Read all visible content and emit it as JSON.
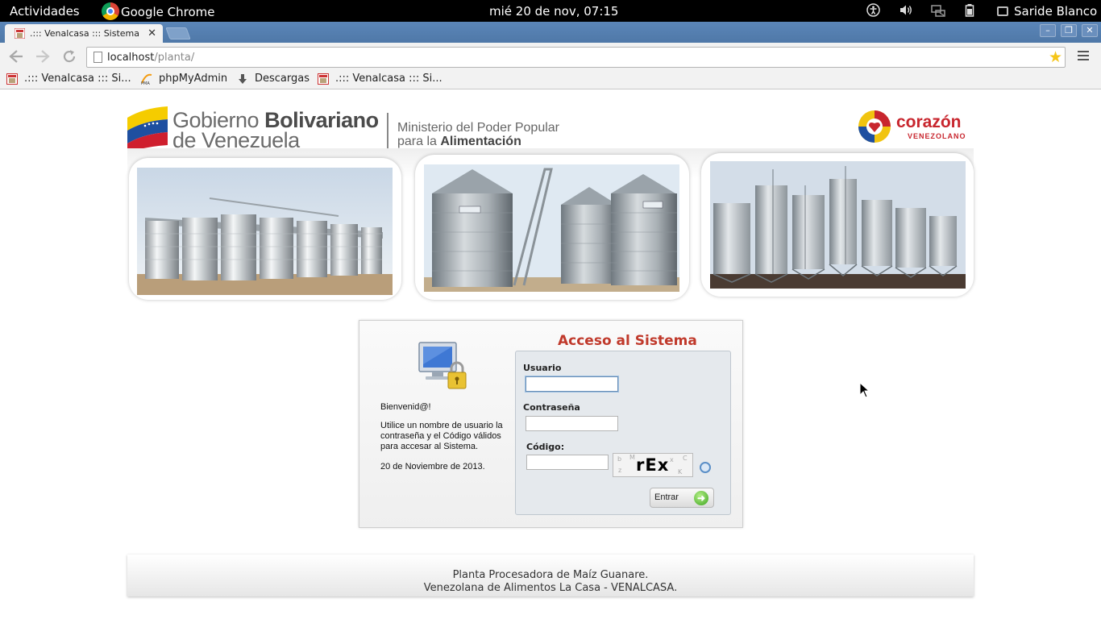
{
  "topbar": {
    "activities": "Actividades",
    "app_name": "Google Chrome",
    "clock": "mié 20 de nov, 07:15",
    "user_name": "Saride Blanco"
  },
  "browser": {
    "tab_title": ".::: Venalcasa ::: Sistema de",
    "url_host": "localhost",
    "url_path": "/planta/",
    "bookmarks": [
      {
        "label": ".::: Venalcasa ::: Si...",
        "icon": "venalcasa-favicon"
      },
      {
        "label": "phpMyAdmin",
        "icon": "phpmyadmin-icon"
      },
      {
        "label": "Descargas",
        "icon": "download-icon"
      },
      {
        "label": ".::: Venalcasa ::: Si...",
        "icon": "venalcasa-favicon"
      }
    ]
  },
  "header": {
    "gov_line1_light": "Gobierno ",
    "gov_line1_bold": "Bolivariano",
    "gov_line2": "de Venezuela",
    "ministry_line1": "Ministerio del Poder Popular",
    "ministry_line2_light": "para la ",
    "ministry_line2_bold": "Alimentación",
    "corazon": "corazón",
    "corazon_sub": "VENEZOLANO"
  },
  "login": {
    "title": "Acceso al Sistema",
    "welcome": "Bienvenid@!",
    "instructions": "Utilice un nombre de usuario la contraseña y el Código válidos para accesar al Sistema.",
    "date": "20 de Noviembre de 2013.",
    "user_label": "Usuario",
    "user_value": "",
    "password_label": "Contraseña",
    "password_value": "",
    "code_label": "Código:",
    "code_value": "",
    "captcha_text": "rEx",
    "enter_label": "Entrar"
  },
  "footer": {
    "line1": "Planta Procesadora de Maíz Guanare.",
    "line2": "Venezolana de Alimentos La Casa - VENALCASA."
  },
  "colors": {
    "accent_title": "#c0392b",
    "tabstrip": "#5b86b8",
    "corazon_red": "#c8262e"
  }
}
